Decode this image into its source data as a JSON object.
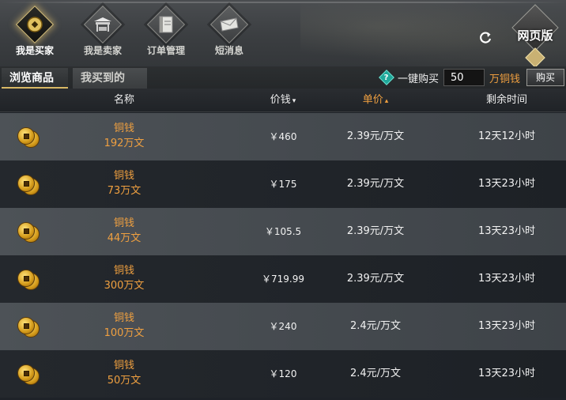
{
  "nav": {
    "items": [
      {
        "label": "我是买家",
        "icon": "buyer-coin-icon",
        "active": true
      },
      {
        "label": "我是卖家",
        "icon": "seller-stall-icon",
        "active": false
      },
      {
        "label": "订单管理",
        "icon": "order-book-icon",
        "active": false
      },
      {
        "label": "短消息",
        "icon": "message-envelope-icon",
        "active": false
      }
    ],
    "refresh_icon": "refresh-icon",
    "web_version_label": "网页版"
  },
  "tabs": [
    {
      "label": "浏览商品",
      "active": true
    },
    {
      "label": "我买到的",
      "active": false
    }
  ],
  "oneclick": {
    "help_glyph": "?",
    "label": "一键购买",
    "quantity": "50",
    "unit": "万铜钱",
    "buy_button": "购买"
  },
  "table": {
    "headers": {
      "name": "名称",
      "price": "价钱",
      "unit_price": "单价",
      "time_left": "剩余时间",
      "sort_arrow": "▾",
      "sort_arrow_up": "▴"
    },
    "rows": [
      {
        "name": "铜钱",
        "amount": "192万文",
        "price": "￥460",
        "unit_price": "2.39元/万文",
        "time_left": "12天12小时"
      },
      {
        "name": "铜钱",
        "amount": "73万文",
        "price": "￥175",
        "unit_price": "2.39元/万文",
        "time_left": "13天23小时"
      },
      {
        "name": "铜钱",
        "amount": "44万文",
        "price": "￥105.5",
        "unit_price": "2.39元/万文",
        "time_left": "13天23小时"
      },
      {
        "name": "铜钱",
        "amount": "300万文",
        "price": "￥719.99",
        "unit_price": "2.39元/万文",
        "time_left": "13天23小时"
      },
      {
        "name": "铜钱",
        "amount": "100万文",
        "price": "￥240",
        "unit_price": "2.4元/万文",
        "time_left": "13天23小时"
      },
      {
        "name": "铜钱",
        "amount": "50万文",
        "price": "￥120",
        "unit_price": "2.4元/万文",
        "time_left": "13天23小时"
      }
    ]
  },
  "colors": {
    "accent_orange": "#f0a040",
    "active_gold": "#d8b865"
  }
}
